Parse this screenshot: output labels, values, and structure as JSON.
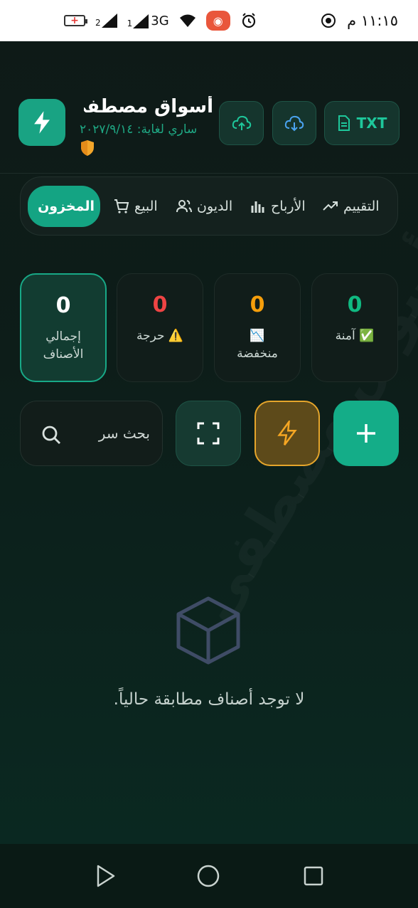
{
  "status_bar": {
    "time": "١١:١٥ م",
    "network": "3G",
    "sim1": "1",
    "sim2": "2"
  },
  "header": {
    "title": "أسواق مصطفى",
    "valid_until": "ساري لغاية: ٢٠٢٧/٩/١٤",
    "txt_button": "TXT",
    "logo_icon": "lightning-icon",
    "accent": "#19a383"
  },
  "tabs": [
    {
      "label": "المخزون",
      "icon": "box-icon",
      "active": true
    },
    {
      "label": "البيع",
      "icon": "cart-icon",
      "active": false
    },
    {
      "label": "الديون",
      "icon": "users-icon",
      "active": false
    },
    {
      "label": "الأرباح",
      "icon": "bar-chart-icon",
      "active": false
    },
    {
      "label": "التقييم",
      "icon": "trend-icon",
      "active": false
    }
  ],
  "stats": [
    {
      "value": "0",
      "label": "إجمالي الأصناف",
      "color": "#ffffff"
    },
    {
      "value": "0",
      "label": "⚠️ حرجة",
      "color": "#ef4444"
    },
    {
      "value": "0",
      "label": "📉 منخفضة",
      "color": "#f59e0b"
    },
    {
      "value": "0",
      "label": "✅ آمنة",
      "color": "#10b981"
    }
  ],
  "search": {
    "placeholder": "بحث سر"
  },
  "watermark": "أسواق مصطفى",
  "empty_state": {
    "message": "لا توجد أصناف مطابقة حالياً."
  }
}
